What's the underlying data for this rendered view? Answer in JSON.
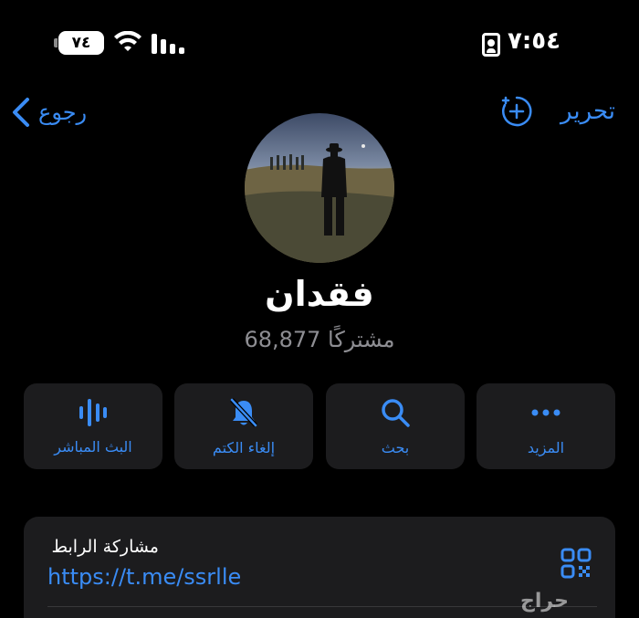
{
  "status_bar": {
    "battery": "٧٤",
    "time": "٧:٥٤"
  },
  "nav": {
    "back_label": "رجوع",
    "edit_label": "تحرير"
  },
  "channel": {
    "name": "فقدان",
    "subscribers": "68,877 مشتركًا"
  },
  "actions": [
    {
      "label": "البث المباشر",
      "icon": "live-stream-icon"
    },
    {
      "label": "إلغاء الكتم",
      "icon": "bell-slash-icon"
    },
    {
      "label": "بحث",
      "icon": "search-icon"
    },
    {
      "label": "المزيد",
      "icon": "more-icon"
    }
  ],
  "link_card": {
    "label": "مشاركة الرابط",
    "url": "https://t.me/ssrlle"
  },
  "watermark": "حراج",
  "colors": {
    "accent": "#3a8cf5",
    "background": "#000000",
    "card": "#1c1c1e",
    "secondary_text": "#8e8e93"
  }
}
